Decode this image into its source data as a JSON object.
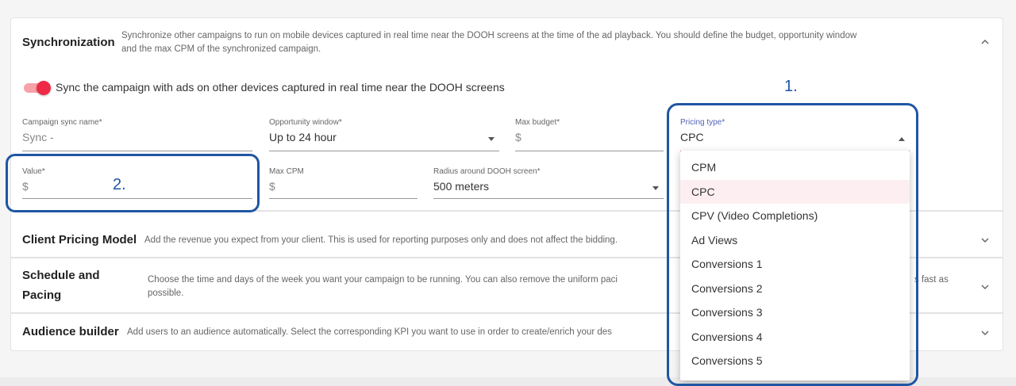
{
  "synchronization": {
    "title": "Synchronization",
    "description_line1": "Synchronize other campaigns to run on mobile devices captured in real time near the DOOH screens at the time of the ad playback. You should define the budget, opportunity window",
    "description_line2": "and the max CPM of the synchronized campaign.",
    "toggle_label": "Sync the campaign with ads on other devices captured in real time near the DOOH screens",
    "toggle_on": true,
    "fields": {
      "campaign_sync_name": {
        "label": "Campaign sync name*",
        "value": "Sync -"
      },
      "opportunity_window": {
        "label": "Opportunity window*",
        "value": "Up to 24 hour"
      },
      "max_budget": {
        "label": "Max budget*",
        "value": "$"
      },
      "pricing_type": {
        "label": "Pricing type*",
        "value": "CPC"
      },
      "value": {
        "label": "Value*",
        "value": "$"
      },
      "max_cpm": {
        "label": "Max CPM",
        "value": "$"
      },
      "radius": {
        "label": "Radius around DOOH screen*",
        "value": "500 meters"
      }
    }
  },
  "pricing_dropdown": {
    "options": [
      "CPM",
      "CPC",
      "CPV (Video Completions)",
      "Ad Views",
      "Conversions 1",
      "Conversions 2",
      "Conversions 3",
      "Conversions 4",
      "Conversions 5"
    ],
    "selected": "CPC"
  },
  "client_pricing": {
    "title": "Client Pricing Model",
    "description": "Add the revenue you expect from your client. This is used for reporting purposes only and does not affect the bidding."
  },
  "schedule": {
    "title_line1": "Schedule and",
    "title_line2": "Pacing",
    "description_line1_left": "Choose the time and days of the week you want your campaign to be running. You can also remove the uniform paci",
    "description_line1_right": "s fast as",
    "description_line2": "possible."
  },
  "audience": {
    "title": "Audience builder",
    "description": "Add users to an audience automatically. Select the corresponding KPI you want to use in order to create/enrich your des"
  },
  "annotations": {
    "callout_1": "1.",
    "callout_2": "2."
  },
  "colors": {
    "accent_red": "#ee2a47",
    "callout_blue": "#1f56a3",
    "active_label": "#5162b7"
  }
}
